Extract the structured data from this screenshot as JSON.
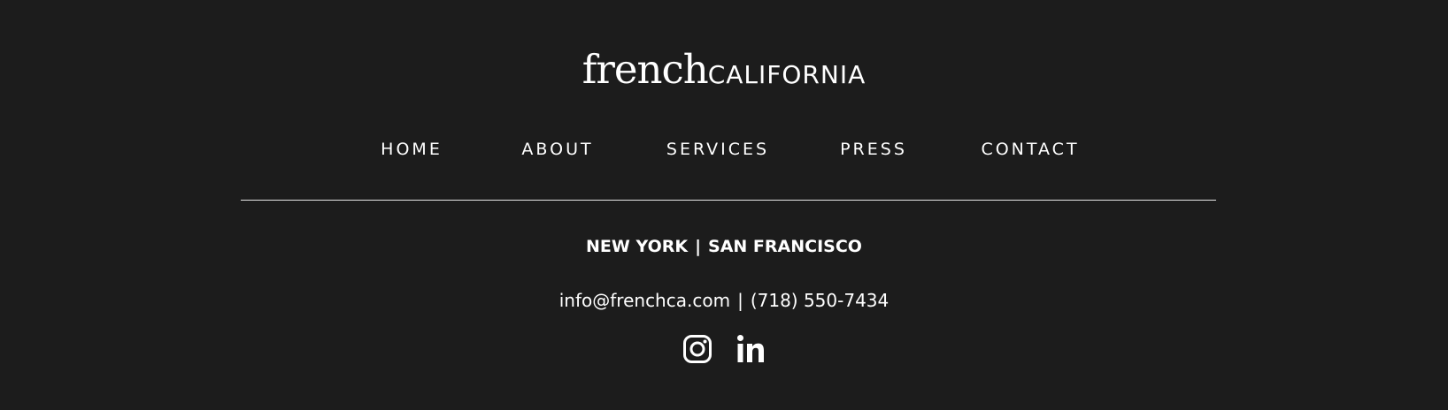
{
  "logo": {
    "script_text": "french",
    "caps_text": "CALIFORNIA"
  },
  "nav": {
    "items": [
      {
        "label": "HOME"
      },
      {
        "label": "ABOUT"
      },
      {
        "label": "SERVICES"
      },
      {
        "label": "PRESS"
      },
      {
        "label": "CONTACT"
      }
    ]
  },
  "locations": {
    "city_1": "NEW YORK",
    "separator": "|",
    "city_2": "SAN FRANCISCO"
  },
  "contact": {
    "email": "info@frenchca.com",
    "separator": "|",
    "phone": "(718) 550-7434"
  },
  "social": {
    "icons": [
      "instagram-icon",
      "linkedin-icon"
    ]
  },
  "colors": {
    "background": "#1c1c1c",
    "text": "#ffffff",
    "divider": "#e6e6e6"
  }
}
